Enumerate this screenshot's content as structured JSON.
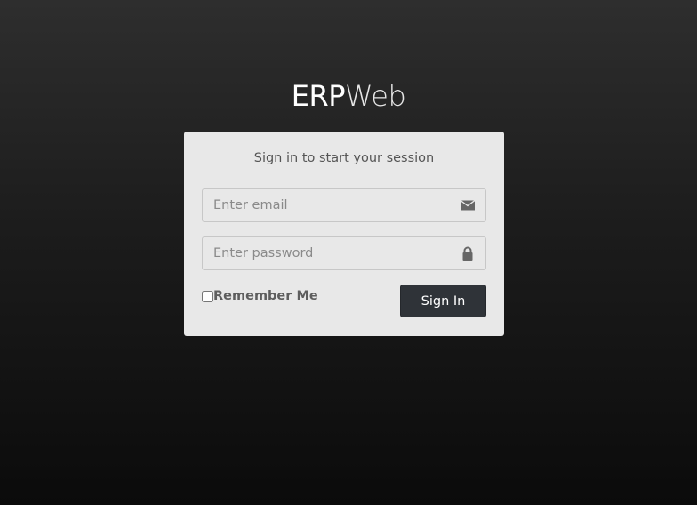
{
  "logo": {
    "bold_part": "ERP",
    "light_part": "Web"
  },
  "login": {
    "message": "Sign in to start your session",
    "email": {
      "placeholder": "Enter email",
      "value": "",
      "icon": "envelope-icon"
    },
    "password": {
      "placeholder": "Enter password",
      "value": "",
      "icon": "lock-icon"
    },
    "remember_label": "Remember Me",
    "remember_checked": false,
    "signin_label": "Sign In"
  },
  "colors": {
    "background_top": "#2e2e2e",
    "background_bottom": "#0b0b0b",
    "box_background": "#e8e8e8",
    "button_background": "#2f3338",
    "button_text": "#ffffff"
  }
}
